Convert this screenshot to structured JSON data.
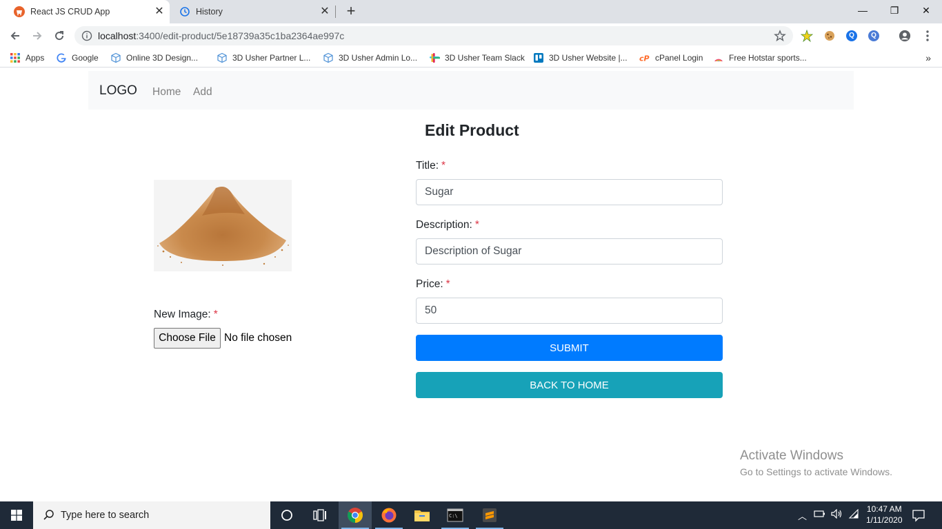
{
  "browser": {
    "tabs": [
      {
        "title": "React JS CRUD App",
        "active": true
      },
      {
        "title": "History",
        "active": false
      }
    ],
    "url_host": "localhost",
    "url_path": ":3400/edit-product/5e18739a35c1ba2364ae997c",
    "bookmarks": [
      {
        "label": "Apps",
        "icon": "apps-grid-icon"
      },
      {
        "label": "Google",
        "icon": "google-icon"
      },
      {
        "label": "Online 3D Design...",
        "icon": "cube-icon"
      },
      {
        "label": "3D Usher Partner L...",
        "icon": "cube-icon"
      },
      {
        "label": "3D Usher Admin Lo...",
        "icon": "cube-icon"
      },
      {
        "label": "3D Usher Team Slack",
        "icon": "slack-icon"
      },
      {
        "label": "3D Usher Website |...",
        "icon": "trello-icon"
      },
      {
        "label": "cPanel Login",
        "icon": "cpanel-icon"
      },
      {
        "label": "Free Hotstar sports...",
        "icon": "hotstar-icon"
      }
    ]
  },
  "app": {
    "logo": "LOGO",
    "nav": {
      "home": "Home",
      "add": "Add"
    },
    "heading": "Edit Product",
    "form": {
      "title_label": "Title:",
      "title_value": "Sugar",
      "description_label": "Description:",
      "description_value": "Description of Sugar",
      "price_label": "Price:",
      "price_value": "50",
      "required_mark": "*",
      "new_image_label": "New Image:",
      "choose_file": "Choose File",
      "no_file": "No file chosen",
      "submit": "SUBMIT",
      "back": "BACK TO HOME"
    }
  },
  "watermark": {
    "line1": "Activate Windows",
    "line2": "Go to Settings to activate Windows."
  },
  "taskbar": {
    "search_placeholder": "Type here to search",
    "time": "10:47 AM",
    "date": "1/11/2020"
  },
  "colors": {
    "primary": "#007bff",
    "info": "#17a2b8",
    "required": "#dc3545",
    "taskbar": "#1f2a38"
  }
}
